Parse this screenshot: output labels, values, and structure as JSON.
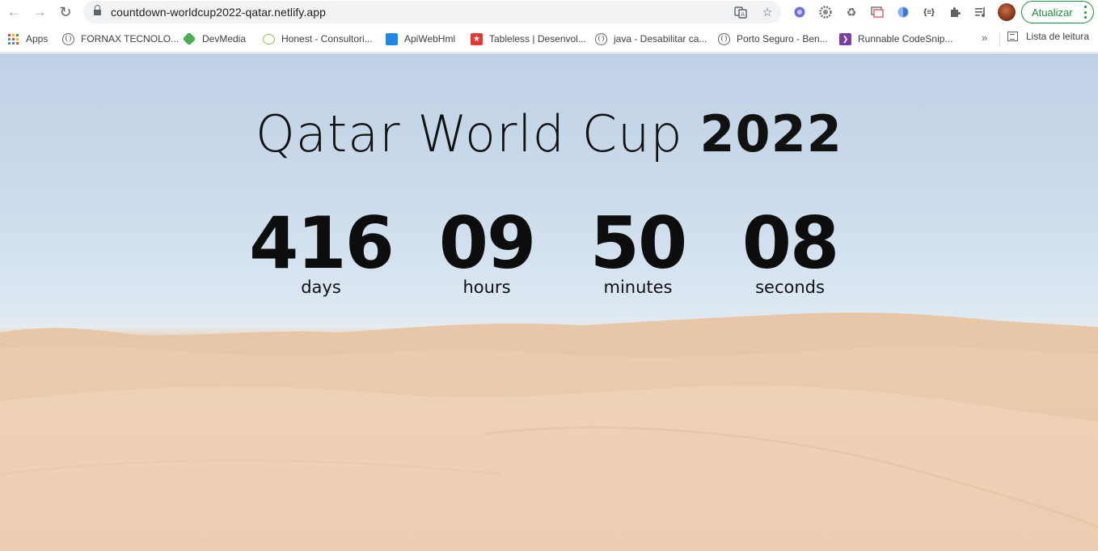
{
  "browser": {
    "url": "countdown-worldcup2022-qatar.netlify.app",
    "update_label": "Atualizar"
  },
  "bookmarks": {
    "items": [
      {
        "label": "Apps",
        "icon": "apps-grid-icon"
      },
      {
        "label": "FORNAX TECNOLO...",
        "icon": "globe-icon"
      },
      {
        "label": "DevMedia",
        "icon": "devmedia-icon"
      },
      {
        "label": "Honest - Consultori...",
        "icon": "honest-icon"
      },
      {
        "label": "ApiWebHml",
        "icon": "api-icon"
      },
      {
        "label": "Tableless | Desenvol...",
        "icon": "tableless-icon"
      },
      {
        "label": "java - Desabilitar ca...",
        "icon": "globe-icon"
      },
      {
        "label": "Porto Seguro - Ben...",
        "icon": "globe-icon"
      },
      {
        "label": "Runnable CodeSnip...",
        "icon": "runnable-icon"
      }
    ],
    "overflow": "»",
    "reading_list": "Lista de leitura"
  },
  "countdown": {
    "title": "Qatar World Cup",
    "year": "2022",
    "units": [
      {
        "value": "416",
        "label": "days"
      },
      {
        "value": "09",
        "label": "hours"
      },
      {
        "value": "50",
        "label": "minutes"
      },
      {
        "value": "08",
        "label": "seconds"
      }
    ]
  },
  "colors": {
    "accent_green": "#1e8e3e",
    "sky": "#c8d8ea",
    "sand": "#e9c9ac"
  }
}
